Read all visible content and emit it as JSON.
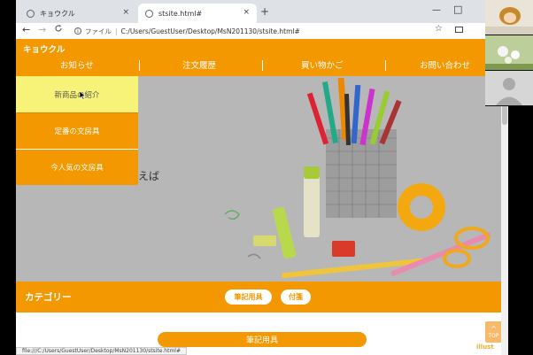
{
  "browser": {
    "tabs": [
      {
        "title": "キョウクル",
        "close": "×",
        "active": false
      },
      {
        "title": "stsite.html#",
        "close": "×",
        "active": true
      }
    ],
    "new_tab": "+",
    "window_min": "—",
    "window_max": "□",
    "nav": {
      "back": "←",
      "forward": "→",
      "reload": "C"
    },
    "address": {
      "info": "i",
      "scheme_label": "ファイル",
      "separator": "|",
      "url": "C:/Users/GuestUser/Desktop/MsN201130/stsite.html#"
    },
    "star": "☆"
  },
  "site": {
    "logo": "キョウクル",
    "nav": [
      "お知らせ",
      "注文履歴",
      "買い物かご",
      "お問い合わせ"
    ],
    "dropdown": [
      "新商品の紹介",
      "定番の文房具",
      "今人気の文房具"
    ],
    "hero_text": "えば",
    "category": {
      "title": "カテゴリー",
      "pills": [
        "筆記用具",
        "付箋"
      ]
    },
    "section_title": "筆記用具",
    "top_button": {
      "arrow": "^",
      "label": "TOP"
    },
    "watermark": "illust"
  },
  "status_bar": "file:///C:/Users/GuestUser/Desktop/MsN201130/stsite.html#",
  "colors": {
    "brand_orange": "#f39800",
    "dropdown_hover": "#f7f379",
    "hero_bg": "#b7b7b7"
  },
  "video_tiles": [
    "person-video-1",
    "person-video-2",
    "avatar-placeholder"
  ]
}
